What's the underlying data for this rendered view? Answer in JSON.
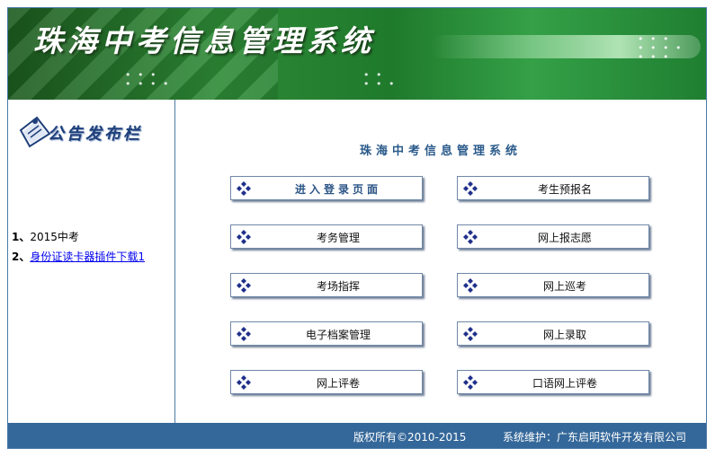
{
  "banner": {
    "title": "珠海中考信息管理系统"
  },
  "sidebar": {
    "notice_board_label": "公告发布栏",
    "notices": [
      {
        "num": "1、",
        "text": "2015中考",
        "link": false
      },
      {
        "num": "2、",
        "text": "身份证读卡器插件下载1",
        "link": true
      }
    ]
  },
  "main": {
    "system_title": "珠海中考信息管理系统",
    "buttons": [
      {
        "label": "进入登录页面"
      },
      {
        "label": "考生预报名"
      },
      {
        "label": "考务管理"
      },
      {
        "label": "网上报志愿"
      },
      {
        "label": "考场指挥"
      },
      {
        "label": "网上巡考"
      },
      {
        "label": "电子档案管理"
      },
      {
        "label": "网上录取"
      },
      {
        "label": "网上评卷"
      },
      {
        "label": "口语网上评卷"
      }
    ]
  },
  "footer": {
    "copyright": "版权所有©2010-2015",
    "maintenance": "系统维护：广东启明软件开发有限公司"
  },
  "colors": {
    "banner_green": "#2d8a36",
    "footer_blue": "#35689a",
    "title_blue": "#2a5a8a",
    "icon_navy": "#1f2f8a"
  }
}
